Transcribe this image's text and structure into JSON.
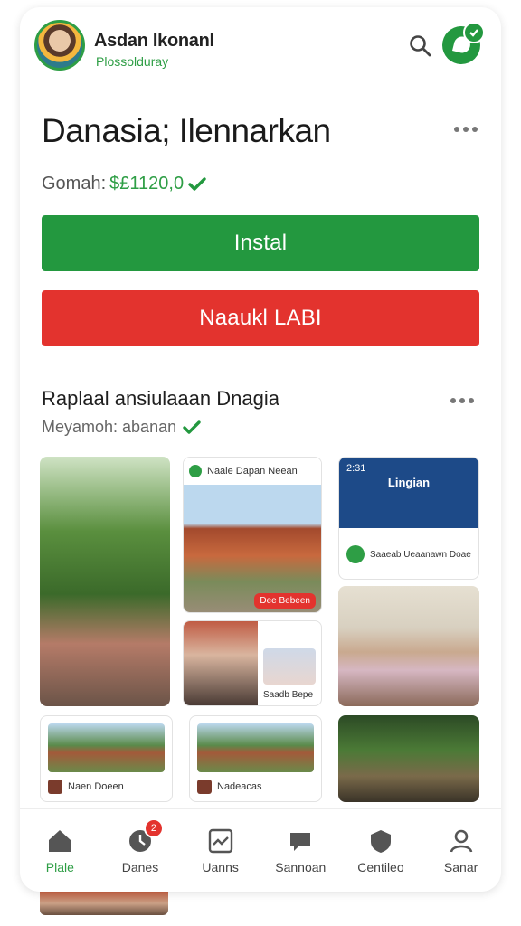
{
  "header": {
    "brand_name": "Asdan Ikonanl",
    "brand_sub": "Plossolduray",
    "search_icon": "search-icon",
    "chat_icon": "chat-icon"
  },
  "app": {
    "title": "Danasia; Ilennarkan",
    "price_label": "Gomah:",
    "price_value": "$£1120,0",
    "install_label": "Instal",
    "secondary_label": "Naaukl LABI"
  },
  "section": {
    "title": "Raplaal ansiulaaan Dnagia",
    "subtitle": "Meyamoh: abanan"
  },
  "tiles": {
    "t2_header": "Naale Dapan Neean",
    "t2_pill": "Dee Bebeen",
    "t3_caption": "Saadb Bepe",
    "t4_time": "2:31",
    "t4_heading": "Lingian",
    "t4_row": "Saaeab Ueaanawn Doae",
    "mini1_caption": "Naen Doeen",
    "mini2_caption": "Nadeacas"
  },
  "nav": {
    "items": [
      {
        "label": "Plale",
        "icon": "home-icon"
      },
      {
        "label": "Danes",
        "icon": "clock-icon",
        "badge": "2"
      },
      {
        "label": "Uanns",
        "icon": "chart-icon"
      },
      {
        "label": "Sannoan",
        "icon": "chat-bubble-icon"
      },
      {
        "label": "Centileo",
        "icon": "shield-icon"
      },
      {
        "label": "Sanar",
        "icon": "person-icon"
      }
    ]
  },
  "colors": {
    "accent": "#23983f",
    "danger": "#e3332e",
    "brand_blue": "#1d4a88"
  }
}
